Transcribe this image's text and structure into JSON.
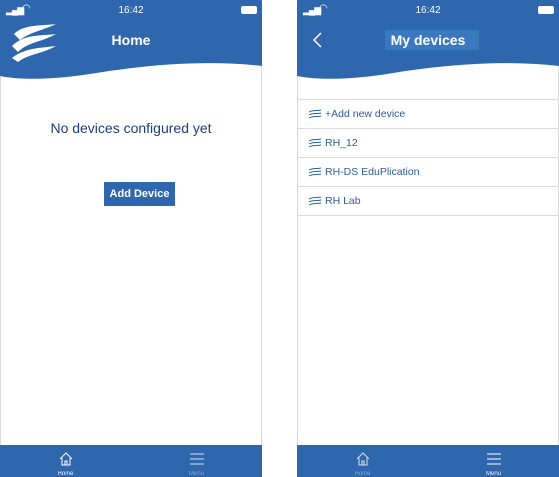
{
  "status_bar": {
    "time": "16:42"
  },
  "screens": [
    {
      "header": {
        "title": "Home"
      },
      "empty_message": "No devices configured yet",
      "add_button_label": "Add Device",
      "tabs": [
        {
          "label": "Home",
          "icon": "home-icon"
        },
        {
          "label": "Menu",
          "icon": "menu-icon"
        }
      ]
    },
    {
      "header": {
        "title": "My devices",
        "back_icon": "chevron-left-icon"
      },
      "devices": [
        {
          "label": "+Add new device"
        },
        {
          "label": "RH_12"
        },
        {
          "label": "RH-DS EduPlication"
        },
        {
          "label": "RH Lab"
        }
      ],
      "tabs": [
        {
          "label": "Home",
          "icon": "home-icon"
        },
        {
          "label": "Menu",
          "icon": "menu-icon"
        }
      ]
    }
  ],
  "colors": {
    "brand_blue": "#2e67ad",
    "header_blue": "#3a79c0",
    "text_blue": "#1f3d7a"
  }
}
